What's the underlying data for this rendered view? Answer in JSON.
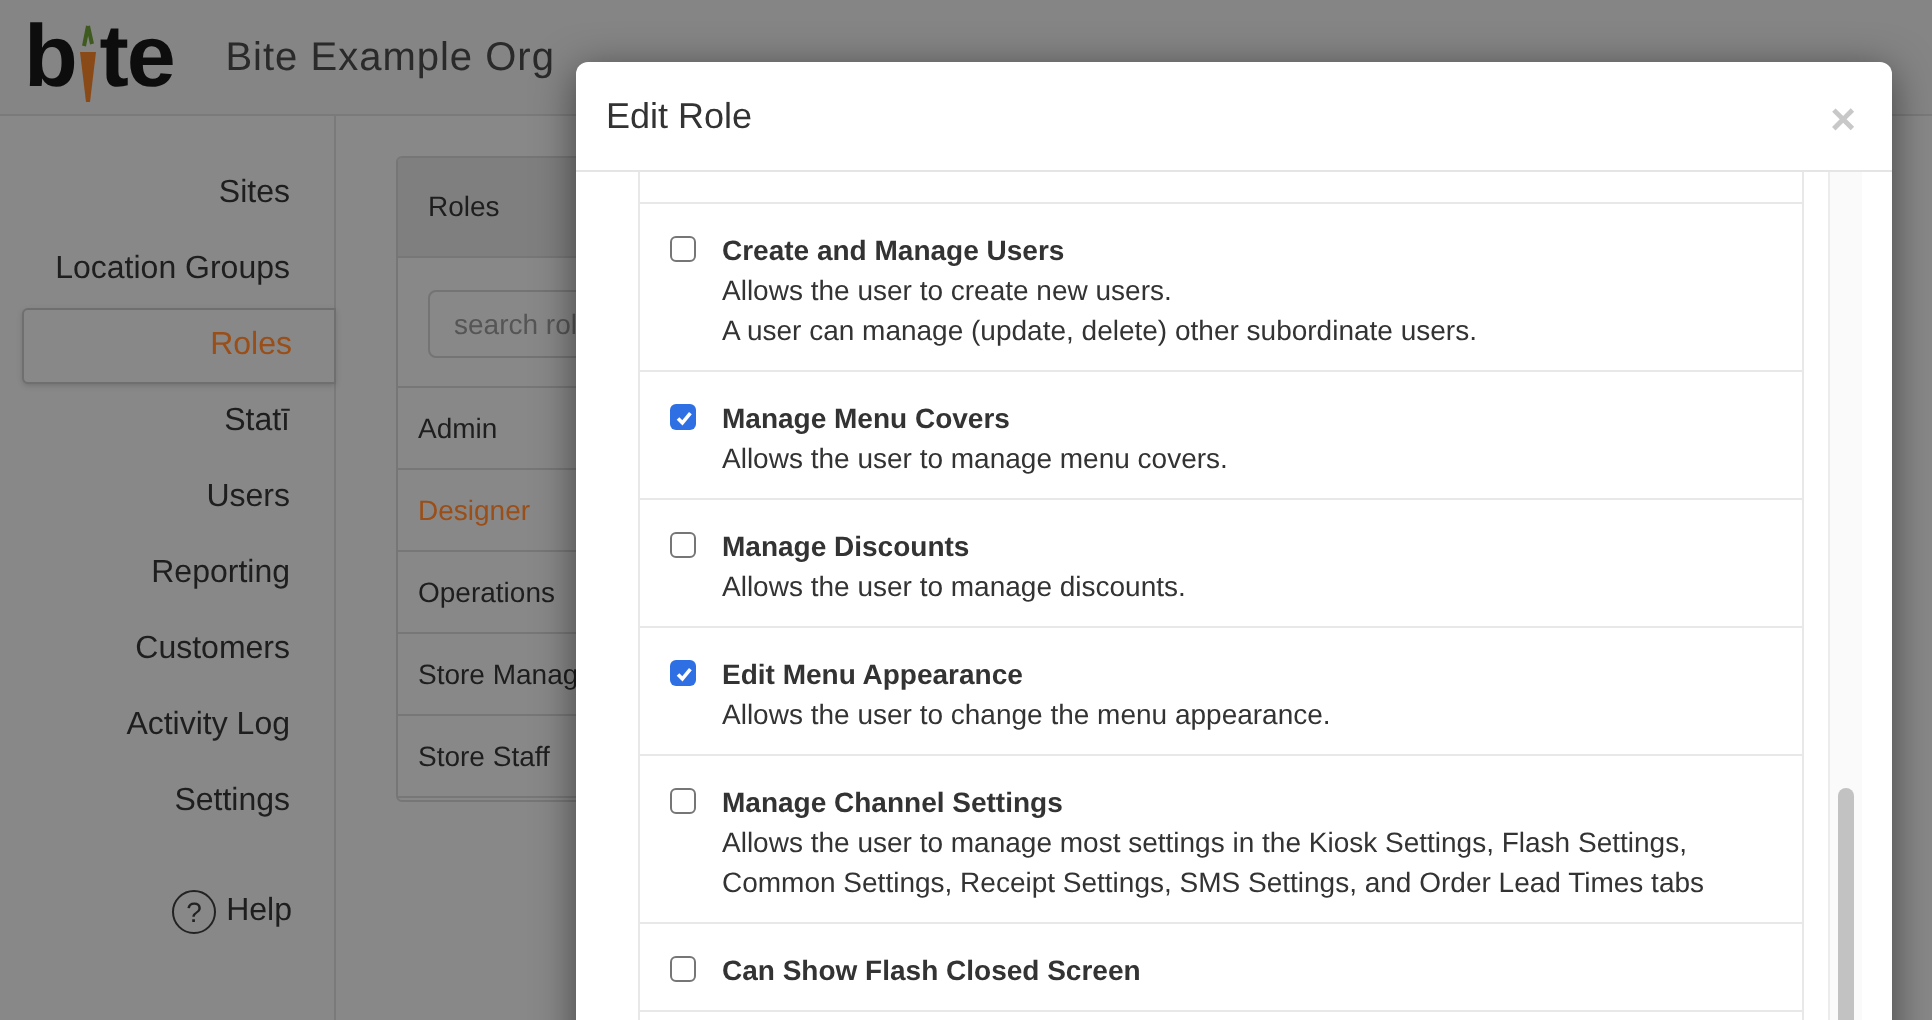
{
  "header": {
    "logo_parts": [
      "b",
      "te"
    ],
    "org_name": "Bite Example Org"
  },
  "sidebar": {
    "items": [
      {
        "label": "Sites",
        "selected": false
      },
      {
        "label": "Location Groups",
        "selected": false
      },
      {
        "label": "Roles",
        "selected": true
      },
      {
        "label": "Statī",
        "selected": false
      },
      {
        "label": "Users",
        "selected": false
      },
      {
        "label": "Reporting",
        "selected": false
      },
      {
        "label": "Customers",
        "selected": false
      },
      {
        "label": "Activity Log",
        "selected": false
      },
      {
        "label": "Settings",
        "selected": false
      }
    ],
    "help": "Help",
    "help_icon": "?"
  },
  "roles_panel": {
    "title": "Roles",
    "search": {
      "placeholder": "search rol"
    },
    "items": [
      {
        "label": "Admin",
        "selected": false
      },
      {
        "label": "Designer",
        "selected": true
      },
      {
        "label": "Operations",
        "selected": false
      },
      {
        "label": "Store Manag",
        "selected": false
      },
      {
        "label": "Store Staff",
        "selected": false
      }
    ]
  },
  "dialog": {
    "title": "Edit Role",
    "close": "×",
    "permissions": [
      {
        "name": "Create and Manage Users",
        "checked": false,
        "description": [
          "Allows the user to create new users.",
          "A user can manage (update, delete) other subordinate users."
        ]
      },
      {
        "name": "Manage Menu Covers",
        "checked": true,
        "description": [
          "Allows the user to manage menu covers."
        ]
      },
      {
        "name": "Manage Discounts",
        "checked": false,
        "description": [
          "Allows the user to manage discounts."
        ]
      },
      {
        "name": "Edit Menu Appearance",
        "checked": true,
        "description": [
          "Allows the user to change the menu appearance."
        ]
      },
      {
        "name": "Manage Channel Settings",
        "checked": false,
        "description": [
          "Allows the user to manage most settings in the Kiosk Settings, Flash Settings,",
          "Common Settings, Receipt Settings, SMS Settings, and Order Lead Times tabs"
        ]
      },
      {
        "name": "Can Show Flash Closed Screen",
        "checked": false
      }
    ]
  }
}
